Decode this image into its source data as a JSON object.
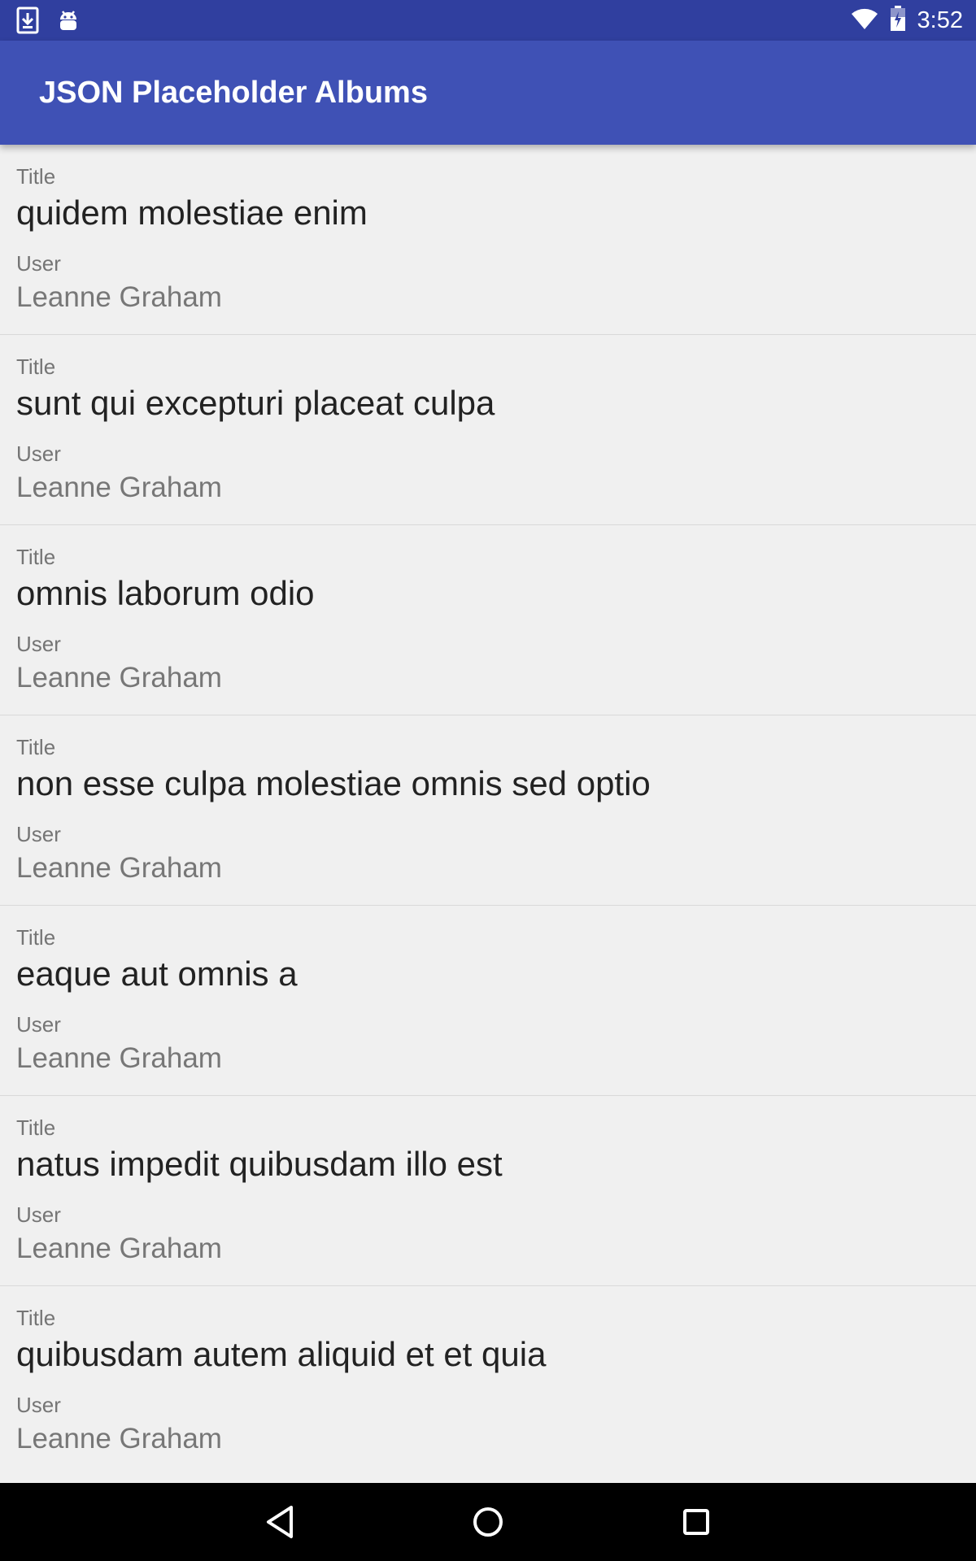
{
  "status_bar": {
    "time": "3:52",
    "icons": [
      "download-icon",
      "android-debug-icon",
      "wifi-icon",
      "battery-charging-icon"
    ]
  },
  "app_bar": {
    "title": "JSON Placeholder Albums"
  },
  "albums": [
    {
      "title_label": "Title",
      "title": "quidem molestiae enim",
      "user_label": "User",
      "user": "Leanne Graham"
    },
    {
      "title_label": "Title",
      "title": "sunt qui excepturi placeat culpa",
      "user_label": "User",
      "user": "Leanne Graham"
    },
    {
      "title_label": "Title",
      "title": "omnis laborum odio",
      "user_label": "User",
      "user": "Leanne Graham"
    },
    {
      "title_label": "Title",
      "title": "non esse culpa molestiae omnis sed optio",
      "user_label": "User",
      "user": "Leanne Graham"
    },
    {
      "title_label": "Title",
      "title": "eaque aut omnis a",
      "user_label": "User",
      "user": "Leanne Graham"
    },
    {
      "title_label": "Title",
      "title": "natus impedit quibusdam illo est",
      "user_label": "User",
      "user": "Leanne Graham"
    },
    {
      "title_label": "Title",
      "title": "quibusdam autem aliquid et et quia",
      "user_label": "User",
      "user": "Leanne Graham"
    }
  ],
  "nav_bar": {
    "buttons": [
      "back-icon",
      "home-icon",
      "recents-icon"
    ]
  },
  "colors": {
    "status_bar": "#303f9f",
    "app_bar": "#3f51b5",
    "background": "#f0f0f0"
  }
}
